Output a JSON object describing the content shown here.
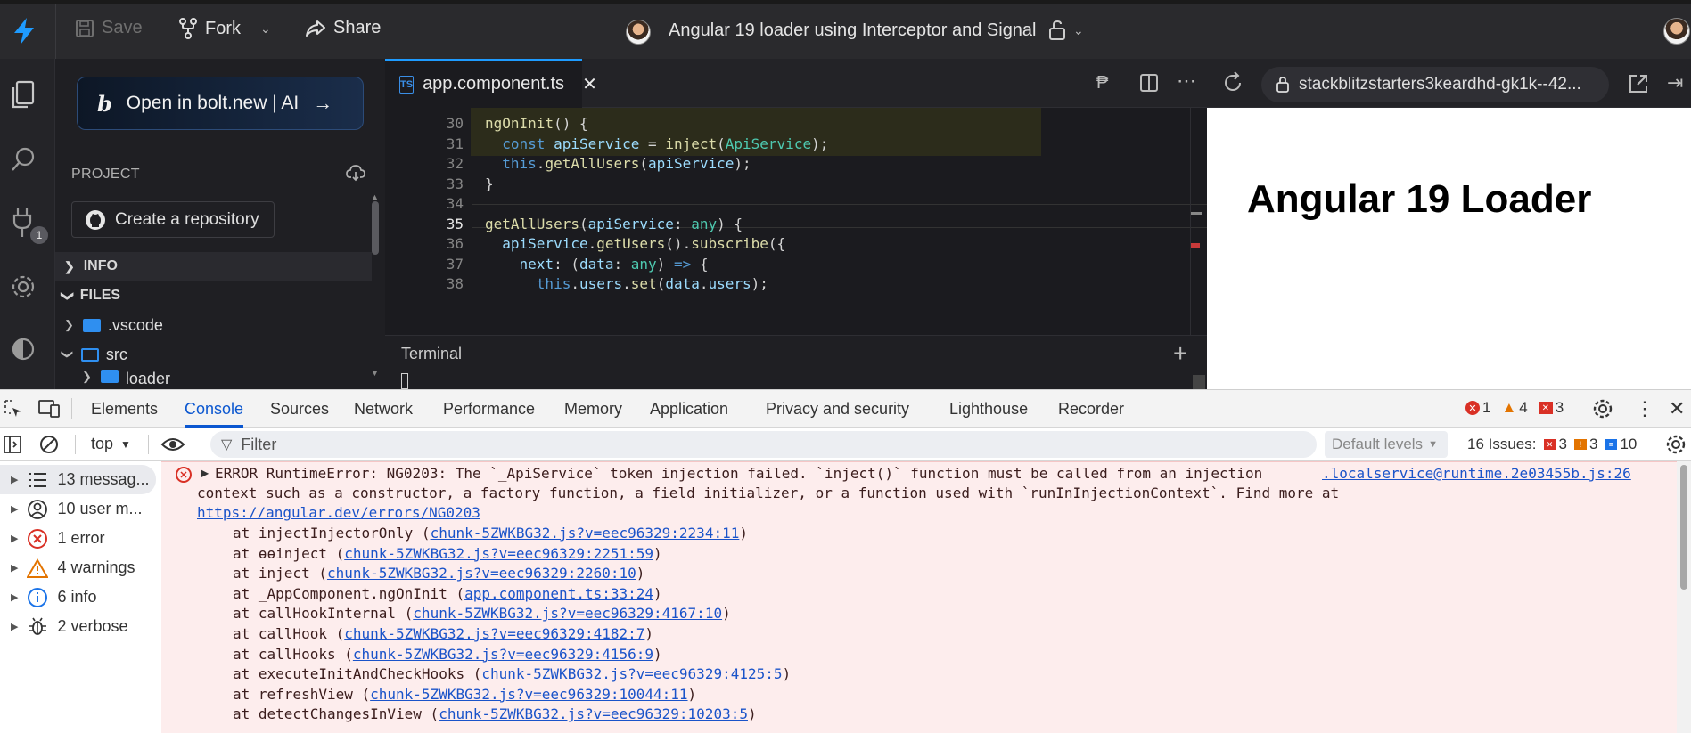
{
  "topbar": {
    "save": "Save",
    "fork": "Fork",
    "share": "Share",
    "project_title": "Angular 19 loader using Interceptor and Signal"
  },
  "rail": {
    "badge": "1"
  },
  "sidebar": {
    "bolt_button": "Open in bolt.new | AI",
    "project_label": "PROJECT",
    "create_repo": "Create a repository",
    "sections": {
      "info": "INFO",
      "files": "FILES"
    },
    "tree": [
      {
        "label": ".vscode",
        "type": "folder"
      },
      {
        "label": "src",
        "type": "folder-open"
      },
      {
        "label": "loader",
        "type": "folder"
      }
    ]
  },
  "editor": {
    "tab_label": "app.component.ts",
    "tab_badge": "TS",
    "address": "stackblitzstarters3keardhd-gk1k--42...",
    "lines": [
      {
        "n": "30",
        "text": "ngOnInit() {"
      },
      {
        "n": "31",
        "text": "  const apiService = inject(ApiService);"
      },
      {
        "n": "32",
        "text": "  this.getAllUsers(apiService);"
      },
      {
        "n": "33",
        "text": "}"
      },
      {
        "n": "34",
        "text": ""
      },
      {
        "n": "35",
        "text": "getAllUsers(apiService: any) {"
      },
      {
        "n": "36",
        "text": "  apiService.getUsers().subscribe({"
      },
      {
        "n": "37",
        "text": "    next: (data: any) => {"
      },
      {
        "n": "38",
        "text": "      this.users.set(data.users);"
      }
    ],
    "terminal_label": "Terminal"
  },
  "preview": {
    "heading": "Angular 19 Loader"
  },
  "devtools": {
    "tabs": [
      "Elements",
      "Console",
      "Sources",
      "Network",
      "Performance",
      "Memory",
      "Application",
      "Privacy and security",
      "Lighthouse",
      "Recorder"
    ],
    "active_tab": "Console",
    "counts": {
      "errors": "1",
      "warnings": "4",
      "messages": "3"
    },
    "context": "top",
    "filter_placeholder": "Filter",
    "levels": "Default levels",
    "issues": {
      "label": "16 Issues:",
      "errors": "3",
      "warnings": "3",
      "info": "10"
    },
    "sidebar": [
      {
        "label": "13 messag...",
        "icon": "list-icon"
      },
      {
        "label": "10 user m...",
        "icon": "user-icon"
      },
      {
        "label": "1 error",
        "icon": "error-icon"
      },
      {
        "label": "4 warnings",
        "icon": "warning-icon"
      },
      {
        "label": "6 info",
        "icon": "info-icon"
      },
      {
        "label": "2 verbose",
        "icon": "bug-icon"
      }
    ],
    "error": {
      "line1": "ERROR RuntimeError: NG0203: The `_ApiService` token injection failed. `inject()` function must be called from an injection",
      "source": ".localservice@runtime.2e03455b.js:26",
      "line2": "context such as a constructor, a factory function, a field initializer, or a function used with `runInInjectionContext`. Find more at",
      "url": "https://angular.dev/errors/NG0203",
      "stack": [
        {
          "fn": "injectInjectorOnly",
          "loc": "chunk-5ZWKBG32.js?v=eec96329:2234:11"
        },
        {
          "fn": "ɵɵinject",
          "loc": "chunk-5ZWKBG32.js?v=eec96329:2251:59"
        },
        {
          "fn": "inject",
          "loc": "chunk-5ZWKBG32.js?v=eec96329:2260:10"
        },
        {
          "fn": "_AppComponent.ngOnInit",
          "loc": "app.component.ts:33:24"
        },
        {
          "fn": "callHookInternal",
          "loc": "chunk-5ZWKBG32.js?v=eec96329:4167:10"
        },
        {
          "fn": "callHook",
          "loc": "chunk-5ZWKBG32.js?v=eec96329:4182:7"
        },
        {
          "fn": "callHooks",
          "loc": "chunk-5ZWKBG32.js?v=eec96329:4156:9"
        },
        {
          "fn": "executeInitAndCheckHooks",
          "loc": "chunk-5ZWKBG32.js?v=eec96329:4125:5"
        },
        {
          "fn": "refreshView",
          "loc": "chunk-5ZWKBG32.js?v=eec96329:10044:11"
        },
        {
          "fn": "detectChangesInView",
          "loc": "chunk-5ZWKBG32.js?v=eec96329:10203:5"
        }
      ]
    }
  }
}
